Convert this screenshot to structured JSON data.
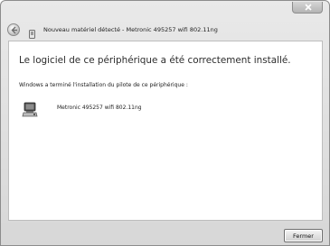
{
  "window": {
    "title": "Nouveau matériel détecté - Metronic 495257 wifi 802.11ng"
  },
  "content": {
    "heading": "Le logiciel de ce périphérique a été correctement installé.",
    "subtext": "Windows a terminé l'installation du pilote de ce périphérique :",
    "device": {
      "name": "Metronic 495257 wifi 802.11ng",
      "icon": "network-adapter-icon"
    }
  },
  "footer": {
    "close_label": "Fermer"
  },
  "colors": {
    "window_frame": "#d7d7d7",
    "content_bg": "#ffffff"
  }
}
